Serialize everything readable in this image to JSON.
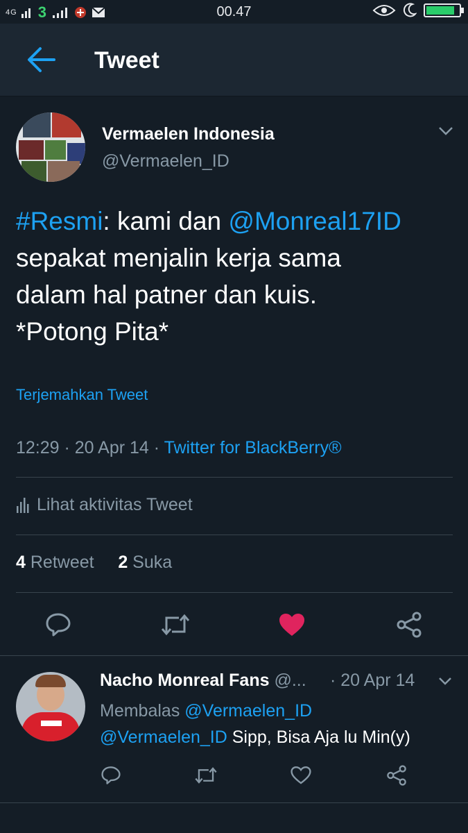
{
  "status_bar": {
    "network_left": "4G",
    "carrier": "3",
    "time": "00.47"
  },
  "header": {
    "back_icon": "arrow-left-icon",
    "title": "Tweet"
  },
  "tweet": {
    "author_name": "Vermaelen Indonesia",
    "author_handle": "@Vermaelen_ID",
    "text": {
      "hashtag": "#Resmi",
      "part1": ": kami dan ",
      "mention": "@Monreal17ID",
      "line2": "sepakat menjalin kerja sama",
      "line3": "dalam hal patner dan kuis.",
      "line4": "*Potong Pita*"
    },
    "translate_label": "Terjemahkan Tweet",
    "timestamp": "12:29 · 20 Apr 14 · ",
    "source": "Twitter for BlackBerry®",
    "activity_label": "Lihat aktivitas Tweet",
    "retweet_count": "4",
    "retweet_label": "Retweet",
    "like_count": "2",
    "like_label": "Suka",
    "liked": true,
    "colors": {
      "accent": "#1da1f2",
      "like": "#e0245e",
      "background": "#141d26",
      "muted": "#8899a6"
    }
  },
  "reply": {
    "author_name": "Nacho Monreal Fans",
    "author_handle": "@...",
    "date": "· 20 Apr 14",
    "replying_prefix": "Membalas ",
    "replying_to": "@Vermaelen_ID",
    "mention": "@Vermaelen_ID",
    "body": " Sipp, Bisa Aja lu Min(y)"
  }
}
